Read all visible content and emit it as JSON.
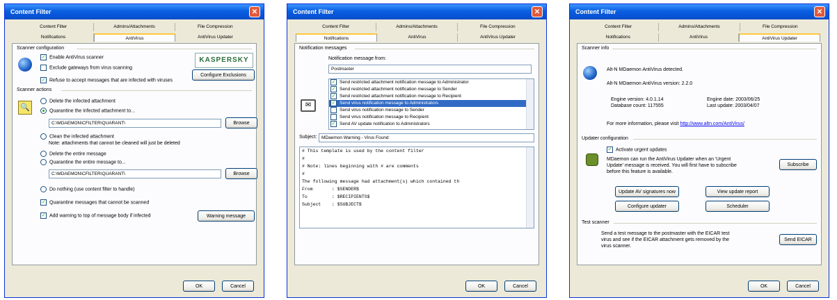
{
  "dialogs": [
    {
      "title": "Content Filter",
      "tabs_top": [
        "Content Filter",
        "Admins/Attachments",
        "File Compression"
      ],
      "tabs_bottom": [
        "Notifications",
        "AntiVirus",
        "AntiVirus Updater"
      ],
      "scanner_config": {
        "group": "Scanner configuration",
        "enable": "Enable AntiVirus scanner",
        "exclude": "Exclude gateways from virus scanning",
        "refuse": "Refuse to accept messages that are infected with viruses",
        "logo": "KASPERSKY",
        "configure_btn": "Configure Exclusions"
      },
      "scanner_actions": {
        "group": "Scanner actions",
        "delete_att": "Delete the infected attachment",
        "quarantine_att": "Quarantine the infected attachment to...",
        "path1": "C:\\MDAEMON\\CFILTER\\QUARANT\\",
        "browse": "Browse",
        "clean": "Clean the infected attachment",
        "clean_note": "Note: attachments that cannot be cleaned will just be deleted",
        "delete_msg": "Delete the entire message",
        "quarantine_msg": "Quarantine the entire message to...",
        "path2": "C:\\MDAEMON\\CFILTER\\QUARANT\\",
        "do_nothing": "Do nothing (use content filter to handle)",
        "quarantine_unscanned": "Quarantine messages that cannot be scanned",
        "add_warning": "Add warning to top of message body if infected",
        "warning_btn": "Warning message"
      },
      "ok": "OK",
      "cancel": "Cancel"
    },
    {
      "title": "Content Filter",
      "tabs_top": [
        "Content Filter",
        "Admins/Attachments",
        "File Compression"
      ],
      "tabs_bottom": [
        "Notifications",
        "AntiVirus",
        "AntiVirus Updater"
      ],
      "group": "Notification messages",
      "from_label": "Notification message from:",
      "from_value": "Postmaster",
      "items": [
        "Send restricted attachment notification message to Administrator",
        "Send restricted attachment notification message to Sender",
        "Send restricted attachment notification message to Recipient",
        "Send virus notification message to Administrators",
        "Send virus notification message to Sender",
        "Send virus notification message to Recipient",
        "Send AV update notification to Administrators"
      ],
      "subject_label": "Subject:",
      "subject_value": "MDaemon Warning - Virus Found",
      "body_lines": [
        "# This template is used by the content filter",
        "#",
        "# Note: lines beginning with # are comments",
        "#",
        "The following message had attachment(s) which contained th",
        "",
        "From       : $SENDER$",
        "To         : $RECIPIENTS$",
        "Subject    : $SUBJECT$"
      ],
      "ok": "OK",
      "cancel": "Cancel"
    },
    {
      "title": "Content Filter",
      "tabs_top": [
        "Content Filter",
        "Admins/Attachments",
        "File Compression"
      ],
      "tabs_bottom": [
        "Notifications",
        "AntiVirus",
        "AntiVirus Updater"
      ],
      "scanner_info": {
        "group": "Scanner info",
        "detected": "Alt-N MDaemon AntiVirus detected.",
        "version": "Alt-N MDaemon AntiVirus version: 2.2.0",
        "engine": "Engine version: 4.0.1.14",
        "dbcount": "Database count: 117555",
        "engine_date": "Engine date: 2003/06/25",
        "last_update": "Last update: 2003/04/07",
        "more_info": "For more information, please visit",
        "link": "http://www.altn.com/AntiVirus/"
      },
      "updater_config": {
        "group": "Updater configuration",
        "activate": "Activate urgent updates",
        "desc1": "MDaemon can run the AntiVirus Updater when an 'Urgent",
        "desc2": "Update' message is received. You will first have to subscribe",
        "desc3": "before this feature is available.",
        "subscribe": "Subscribe",
        "update_now": "Update AV signatures now",
        "view_report": "View update report",
        "configure": "Configure updater",
        "scheduler": "Scheduler"
      },
      "test_scanner": {
        "group": "Test scanner",
        "desc1": "Send a test message to the postmaster with the EICAR test",
        "desc2": "virus and see if the EICAR attachment gets removed by the",
        "desc3": "virus scanner.",
        "send": "Send EICAR"
      },
      "ok": "OK",
      "cancel": "Cancel"
    }
  ]
}
